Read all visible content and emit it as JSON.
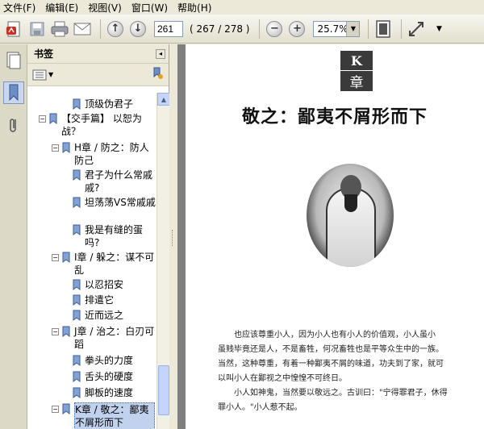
{
  "menu": [
    "文件(F)",
    "编辑(E)",
    "视图(V)",
    "窗口(W)",
    "帮助(H)"
  ],
  "toolbar": {
    "page_number": "261",
    "page_count": "( 267 / 278 )",
    "zoom": "25.7%",
    "minus": "−",
    "plus": "+"
  },
  "panel": {
    "title": "书签",
    "close": "◂"
  },
  "bookmarks": [
    {
      "label": "顶级伪君子"
    },
    {
      "label": "【交手篇】 以恕为战？"
    },
    {
      "label": "H章 / 防之：防人防己"
    },
    {
      "label": "君子为什么常戚戚?"
    },
    {
      "label": "坦荡荡VS常戚戚"
    },
    {
      "label": "我是有缝的蛋吗?"
    },
    {
      "label": "I章 / 躲之：谋不可乱"
    },
    {
      "label": "以忍招安"
    },
    {
      "label": "排遣它"
    },
    {
      "label": "近而远之"
    },
    {
      "label": "J章 / 治之：白刃可蹈"
    },
    {
      "label": "拳头的力度"
    },
    {
      "label": "舌头的硬度"
    },
    {
      "label": "脚板的速度"
    },
    {
      "label": "K章 / 敬之：鄙夷不屑形而下"
    }
  ],
  "document": {
    "chapter_letter": "K",
    "chapter_word": "章",
    "title": "敬之：鄙夷不屑形而下",
    "paragraphs": [
      "也应该尊重小人，因为小人也有小人的价值观，小人虽小",
      "虽贱毕竟还是人，不是畜牲，何况畜牲也是平等众生中的一族。",
      "当然，这种尊重，有着一种鄙夷不屑的味道，功夫到了家，就可",
      "以叫小人在鄙视之中惶惶不可终日。",
      "小人如神鬼，当然要以敬远之。古训曰：\"宁得罪君子，休得",
      "罪小人。\"小人惹不起。"
    ]
  }
}
